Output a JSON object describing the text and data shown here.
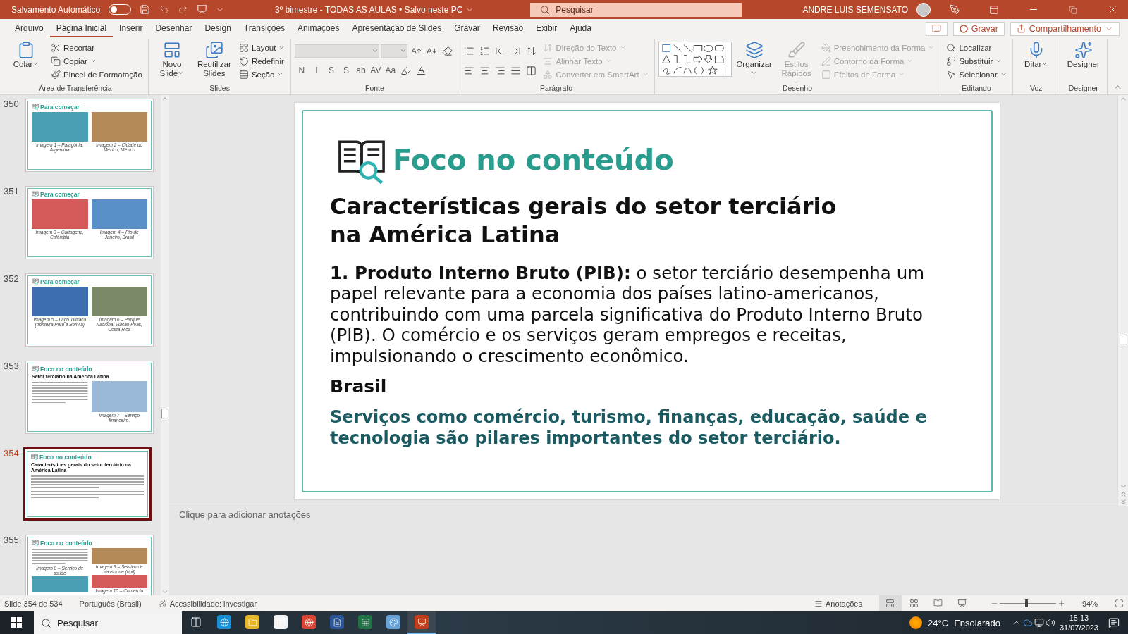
{
  "title_bar": {
    "autosave_label": "Salvamento Automático",
    "autosave_on": false,
    "document_title": "3º bimestre - TODAS AS AULAS  •  Salvo neste PC",
    "search_placeholder": "Pesquisar",
    "user_name": "ANDRE LUIS SEMENSATO"
  },
  "menu_tabs": [
    {
      "label": "Arquivo",
      "selected": false
    },
    {
      "label": "Página Inicial",
      "selected": true
    },
    {
      "label": "Inserir",
      "selected": false
    },
    {
      "label": "Desenhar",
      "selected": false
    },
    {
      "label": "Design",
      "selected": false
    },
    {
      "label": "Transições",
      "selected": false
    },
    {
      "label": "Animações",
      "selected": false
    },
    {
      "label": "Apresentação de Slides",
      "selected": false
    },
    {
      "label": "Gravar",
      "selected": false
    },
    {
      "label": "Revisão",
      "selected": false
    },
    {
      "label": "Exibir",
      "selected": false
    },
    {
      "label": "Ajuda",
      "selected": false
    }
  ],
  "ribbon_actions": {
    "record": "Gravar",
    "share": "Compartilhamento"
  },
  "ribbon_groups": [
    {
      "label": "Área de Transferência",
      "blocks": [
        {
          "kind": "large",
          "items": [
            {
              "label": "Colar",
              "menu": true,
              "disabled": false
            }
          ]
        },
        {
          "kind": "stack",
          "items": [
            {
              "label": "Recortar",
              "menu": false,
              "disabled": false
            },
            {
              "label": "Copiar",
              "menu": true,
              "disabled": false
            },
            {
              "label": "Pincel de Formatação",
              "menu": false,
              "disabled": false
            }
          ]
        }
      ]
    },
    {
      "label": "Slides",
      "blocks": [
        {
          "kind": "large",
          "items": [
            {
              "label": "Novo Slide",
              "menu": true,
              "disabled": false
            }
          ]
        },
        {
          "kind": "large",
          "items": [
            {
              "label": "Reutilizar Slides",
              "menu": false,
              "disabled": false
            }
          ]
        },
        {
          "kind": "stack",
          "items": [
            {
              "label": "Layout",
              "menu": true,
              "disabled": false
            },
            {
              "label": "Redefinir",
              "menu": false,
              "disabled": false
            },
            {
              "label": "Seção",
              "menu": true,
              "disabled": false
            }
          ]
        }
      ]
    },
    {
      "label": "Fonte",
      "blocks": [
        {
          "kind": "rows",
          "rows": [
            [
              {
                "kind": "font-combo"
              },
              {
                "kind": "size-combo"
              },
              {
                "kind": "icon"
              },
              {
                "kind": "icon"
              },
              {
                "kind": "icon"
              }
            ],
            [
              {
                "kind": "glyph",
                "label": "N"
              },
              {
                "kind": "glyph",
                "label": "I"
              },
              {
                "kind": "glyph",
                "label": "S"
              },
              {
                "kind": "glyph",
                "label": "S"
              },
              {
                "kind": "glyph",
                "label": "ab"
              },
              {
                "kind": "glyph",
                "label": "AV"
              },
              {
                "kind": "glyph",
                "label": "Aa"
              },
              {
                "kind": "icon"
              },
              {
                "kind": "icon"
              }
            ]
          ]
        }
      ]
    },
    {
      "label": "Parágrafo",
      "blocks": [
        {
          "kind": "rows",
          "rows": [
            [
              {
                "kind": "icon"
              },
              {
                "kind": "icon"
              },
              {
                "kind": "icon"
              },
              {
                "kind": "icon"
              },
              {
                "kind": "icon"
              }
            ],
            [
              {
                "kind": "icon"
              },
              {
                "kind": "icon"
              },
              {
                "kind": "icon"
              },
              {
                "kind": "icon"
              },
              {
                "kind": "icon"
              }
            ]
          ]
        },
        {
          "kind": "stack",
          "items": [
            {
              "label": "Direção do Texto",
              "menu": true,
              "disabled": true
            },
            {
              "label": "Alinhar Texto",
              "menu": true,
              "disabled": true
            },
            {
              "label": "Converter em SmartArt",
              "menu": true,
              "disabled": true
            }
          ]
        }
      ]
    },
    {
      "label": "Desenho",
      "blocks": [
        {
          "kind": "gallery"
        },
        {
          "kind": "large",
          "items": [
            {
              "label": "Organizar",
              "menu": true,
              "disabled": false
            }
          ]
        },
        {
          "kind": "large",
          "items": [
            {
              "label": "Estilos Rápidos",
              "menu": true,
              "disabled": true
            }
          ]
        },
        {
          "kind": "stack",
          "items": [
            {
              "label": "Preenchimento da Forma",
              "menu": true,
              "disabled": true
            },
            {
              "label": "Contorno da Forma",
              "menu": true,
              "disabled": true
            },
            {
              "label": "Efeitos de Forma",
              "menu": true,
              "disabled": true
            }
          ]
        }
      ]
    },
    {
      "label": "Editando",
      "blocks": [
        {
          "kind": "stack",
          "items": [
            {
              "label": "Localizar",
              "menu": false,
              "disabled": false
            },
            {
              "label": "Substituir",
              "menu": true,
              "disabled": false
            },
            {
              "label": "Selecionar",
              "menu": true,
              "disabled": false
            }
          ]
        }
      ]
    },
    {
      "label": "Voz",
      "blocks": [
        {
          "kind": "large",
          "items": [
            {
              "label": "Ditar",
              "menu": true,
              "disabled": false
            }
          ]
        }
      ]
    },
    {
      "label": "Designer",
      "blocks": [
        {
          "kind": "large",
          "items": [
            {
              "label": "Designer",
              "menu": false,
              "disabled": false
            }
          ]
        }
      ]
    }
  ],
  "thumbnails": [
    {
      "number": "350",
      "selected": false,
      "kind": "photos",
      "title": "Para começar",
      "captions": [
        "Imagem 1 – Patagônia, Argentina",
        "Imagem 2 – Cidade do México, México"
      ]
    },
    {
      "number": "351",
      "selected": false,
      "kind": "photos",
      "title": "Para começar",
      "captions": [
        "Imagem 3 – Cartagena, Colômbia",
        "Imagem 4 – Rio de Janeiro, Brasil"
      ]
    },
    {
      "number": "352",
      "selected": false,
      "kind": "photos",
      "title": "Para começar",
      "captions": [
        "Imagem 5 – Lago Titicaca (fronteira Peru e Bolívia)",
        "Imagem 6 – Parque Nacional Vulcão Poás, Costa Rica"
      ]
    },
    {
      "number": "353",
      "selected": false,
      "kind": "text-photo",
      "title": "Foco no conteúdo",
      "heading": "Setor terciário na América Latina",
      "captions": [
        "Imagem 7 – Serviço financeiro."
      ]
    },
    {
      "number": "354",
      "selected": true,
      "kind": "text",
      "title": "Foco no conteúdo",
      "heading": "Características gerais do setor terciário na América Latina"
    },
    {
      "number": "355",
      "selected": false,
      "kind": "mixed",
      "title": "Foco no conteúdo",
      "captions": [
        "Imagem 8 – Serviço de saúde",
        "Imagem 9 – Serviço de transporte (táxi)",
        "Imagem 10 – Comércio"
      ]
    }
  ],
  "slide": {
    "section_title": "Foco no conteúdo",
    "heading_lines": [
      "Características gerais do setor terciário",
      "na América Latina"
    ],
    "paragraph": "**1. Produto Interno Bruto (PIB):** o setor terciário desempenha um papel relevante para a economia dos países latino-americanos, contribuindo com uma parcela significativa do Produto Interno Bruto (PIB). O comércio e os serviços geram empregos e receitas, impulsionando o crescimento econômico.",
    "subheading": "Brasil",
    "highlight": "Serviços como comércio, turismo, finanças, educação, saúde e tecnologia são pilares importantes do setor terciário."
  },
  "notes": {
    "placeholder": "Clique para adicionar anotações"
  },
  "status_bar": {
    "slide_position": "Slide 354 de 534",
    "language": "Português (Brasil)",
    "accessibility": "Acessibilidade: investigar",
    "notes": "Anotações",
    "views": [
      {
        "selected": true
      },
      {
        "selected": false
      },
      {
        "selected": false
      },
      {
        "selected": false
      }
    ],
    "zoom": {
      "level": 0.47,
      "reading": "94%"
    }
  },
  "taskbar": {
    "search_placeholder": "Pesquisar",
    "apps": [
      {
        "selected": false
      },
      {
        "selected": false
      },
      {
        "selected": false
      },
      {
        "selected": false
      },
      {
        "selected": false
      },
      {
        "selected": false
      },
      {
        "selected": false
      },
      {
        "selected": true
      }
    ],
    "temperature": "24°C",
    "weather": "Ensolarado",
    "time": "15:13",
    "date": "31/07/2023"
  }
}
